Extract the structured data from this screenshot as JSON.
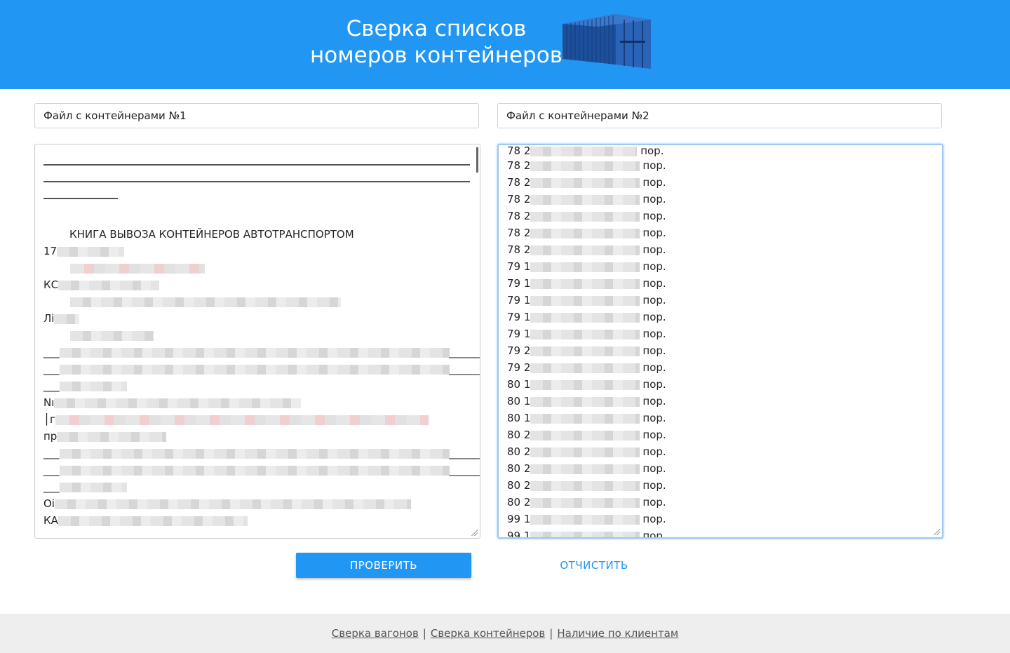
{
  "header": {
    "title_line1": "Сверка списков",
    "title_line2": "номеров контейнеров",
    "color": "#2196f3"
  },
  "file1": {
    "label": "Файл с контейнерами №1"
  },
  "file2": {
    "label": "Файл с контейнерами №2"
  },
  "textarea1": {
    "heading": "КНИГА ВЫВОЗА КОНТЕЙНЕРОВ АВТОТРАНСПОРТОМ",
    "line_prefixes": [
      "17",
      "КС",
      "Лі",
      "Nı",
      "пр",
      "Оі",
      "КА"
    ]
  },
  "textarea2": {
    "first_line": "78 2",
    "last_line": "99 123 CICU2044684 /00 пор.",
    "rows": [
      {
        "prefix": "78 2",
        "suffix": "пор."
      },
      {
        "prefix": "78 2",
        "suffix": "пор."
      },
      {
        "prefix": "78 2",
        "suffix": "пор."
      },
      {
        "prefix": "78 2",
        "suffix": "пор."
      },
      {
        "prefix": "78 2",
        "suffix": "пор."
      },
      {
        "prefix": "78 2",
        "suffix": "пор."
      },
      {
        "prefix": "79 1",
        "suffix": "пор."
      },
      {
        "prefix": "79 1",
        "suffix": "пор."
      },
      {
        "prefix": "79 1",
        "suffix": "пор."
      },
      {
        "prefix": "79 1",
        "suffix": "пор."
      },
      {
        "prefix": "79 1",
        "suffix": "пор."
      },
      {
        "prefix": "79 2",
        "suffix": "пор."
      },
      {
        "prefix": "79 2",
        "suffix": "пор."
      },
      {
        "prefix": "80 1",
        "suffix": "пор."
      },
      {
        "prefix": "80 1",
        "suffix": "пор."
      },
      {
        "prefix": "80 1",
        "suffix": "пор."
      },
      {
        "prefix": "80 2",
        "suffix": "пор."
      },
      {
        "prefix": "80 2",
        "suffix": "пор."
      },
      {
        "prefix": "80 2",
        "suffix": "пор."
      },
      {
        "prefix": "80 2",
        "suffix": "пор."
      },
      {
        "prefix": "80 2",
        "suffix": "пор."
      },
      {
        "prefix": "99 1",
        "suffix": "пор."
      },
      {
        "prefix": "99 1",
        "suffix": "пор."
      }
    ]
  },
  "buttons": {
    "check_label": "ПРОВЕРИТЬ",
    "clear_label": "ОТЧИСТИТЬ"
  },
  "footer": {
    "links": [
      "Сверка вагонов",
      "Сверка контейнеров",
      "Наличие по клиентам"
    ],
    "separator": "|"
  }
}
